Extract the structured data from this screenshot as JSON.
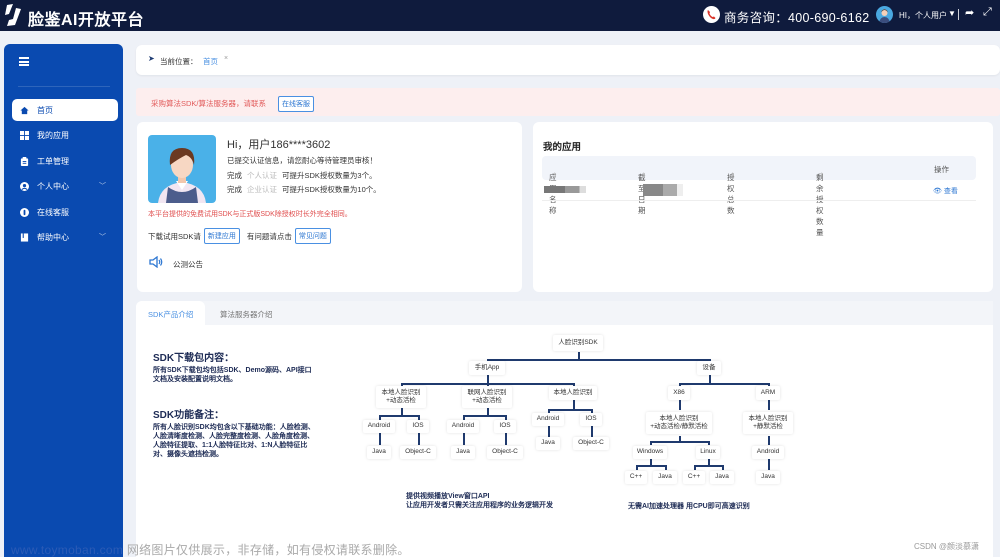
{
  "header": {
    "brand": "脸鉴AI开放平台",
    "phone_label": "商务咨询：400-690-6162",
    "user_label": "HI，个人用户",
    "icons": [
      "logo-icon",
      "phone-icon",
      "avatar",
      "caret-down-icon",
      "share-icon",
      "fullscreen-icon"
    ]
  },
  "sidebar": {
    "items": [
      {
        "label": "首页",
        "icon": "home-icon",
        "active": true
      },
      {
        "label": "我的应用",
        "icon": "grid-icon"
      },
      {
        "label": "工单管理",
        "icon": "clipboard-icon"
      },
      {
        "label": "个人中心",
        "icon": "user-circle-icon",
        "expandable": true
      },
      {
        "label": "在线客服",
        "icon": "headset-icon"
      },
      {
        "label": "帮助中心",
        "icon": "book-icon",
        "expandable": true
      }
    ]
  },
  "breadcrumb": {
    "label": "当前位置：",
    "current": "首页",
    "close": "×"
  },
  "alert": {
    "text": "采购算法SDK/算法服务器，请联系",
    "button": "在线客服"
  },
  "user_card": {
    "greeting": "Hi，用户186****3602",
    "status": "已提交认证信息，请您耐心等待管理员审核！",
    "line1_prefix": "完成",
    "line1_link": "个人认证",
    "line1_suffix": "可提升SDK授权数量为3个。",
    "line2_prefix": "完成",
    "line2_link": "企业认证",
    "line2_suffix": "可提升SDK授权数量为10个。",
    "notice_red": "本平台提供的免费试用SDK与正式版SDK除授权时长外完全相同。",
    "download_prefix": "下载试用SDK请",
    "new_app_button": "新建应用",
    "question_prefix": "有问题请点击",
    "faq_button": "常见问题",
    "announcement": "公测公告"
  },
  "apps": {
    "title": "我的应用",
    "columns": [
      "应用名称",
      "截至日期",
      "授权总数",
      "剩余授权数量",
      "操作"
    ],
    "rows": [
      {
        "name": "[redacted]",
        "date": "[redacted]",
        "total": "",
        "remaining": "",
        "action": "查看"
      }
    ]
  },
  "tabs": {
    "items": [
      {
        "label": "SDK产品介绍",
        "active": true
      },
      {
        "label": "算法服务器介绍",
        "active": false
      }
    ]
  },
  "sdk_intro": {
    "package_title": "SDK下载包内容：",
    "package_text": "所有SDK下载包均包括SDK、Demo源码、API接口文档及安装配置说明文档。",
    "features_title": "SDK功能备注：",
    "features_text": "所有人脸识别SDK均包含以下基础功能：人脸检测、人脸清晰度检测、人脸完整度检测、人脸角度检测、人脸特征提取、1:1人脸特征比对、1:N人脸特征比对、摄像头遮挡检测。",
    "tree": {
      "root": "人脸识别SDK",
      "mobile": "手机App",
      "device": "设备",
      "m1": "本地人脸识别\n+动态活检",
      "m2": "联网人脸识别\n+动态活检",
      "m3": "本地人脸识别",
      "android": "Android",
      "ios": "IOS",
      "java": "Java",
      "objc": "Object-C",
      "x86": "X86",
      "arm": "ARM",
      "x86_feat": "本地人脸识别\n+动态活检/静默活检",
      "arm_feat": "本地人脸识别\n+静默活检",
      "windows": "Windows",
      "linux": "Linux",
      "cpp": "C++"
    },
    "note_mobile": "提供视频播放View窗口API\n让应用开发者只需关注应用程序的业务逻辑开发",
    "note_device": "无需AI加速处理器 用CPU即可高速识别"
  },
  "watermark": {
    "site": "www.toymoban.com",
    "text": " 网络图片仅供展示，非存储，如有侵权请联系删除。",
    "author": "CSDN @颜淡慕潇"
  }
}
